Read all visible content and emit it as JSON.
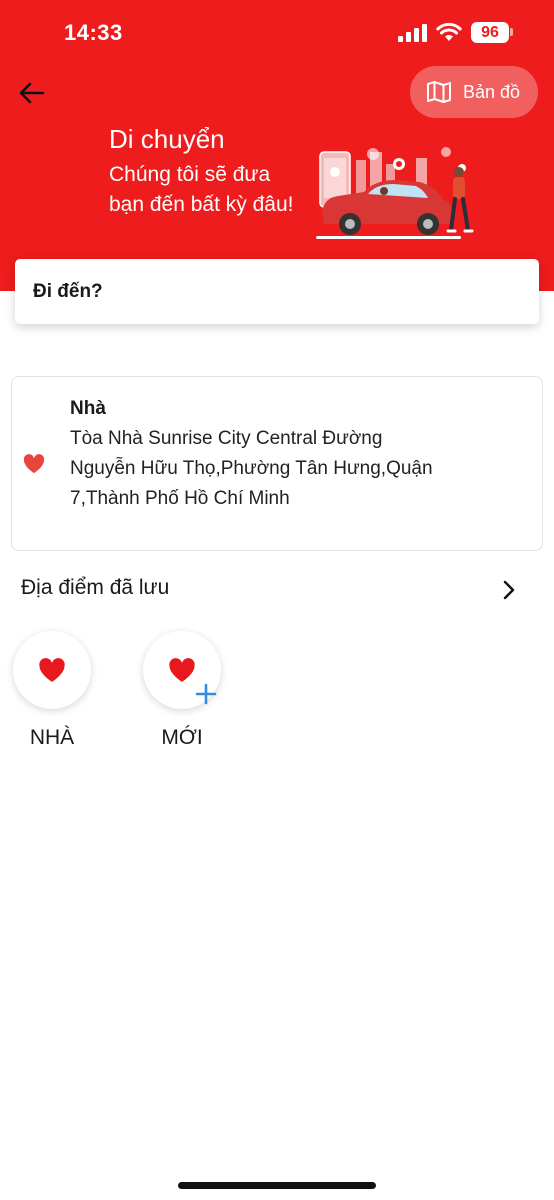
{
  "status_bar": {
    "time": "14:33",
    "battery": "96"
  },
  "header": {
    "map_button_label": "Bản đồ",
    "title": "Di chuyển",
    "subtitle": "Chúng tôi sẽ đưa bạn đến bất kỳ đâu!",
    "icons": [
      "back-arrow-icon",
      "map-icon",
      "car-illustration"
    ]
  },
  "destination": {
    "placeholder": "Đi đến?"
  },
  "home_place": {
    "name": "Nhà",
    "address": "Tòa Nhà Sunrise City Central Đường Nguyễn Hữu Thọ,Phường Tân Hưng,Quận 7,Thành Phố Hồ Chí Minh",
    "icon": "heart-icon"
  },
  "saved_places": {
    "label": "Địa điểm đã lưu",
    "items": [
      {
        "label": "NHÀ",
        "icon": "heart-icon"
      },
      {
        "label": "MỚI",
        "icon": "heart-plus-icon"
      }
    ]
  },
  "colors": {
    "brand_red": "#ee1c1c",
    "map_button": "#f15f5f",
    "heart": "#e8191e",
    "plus": "#2f8fe0"
  }
}
